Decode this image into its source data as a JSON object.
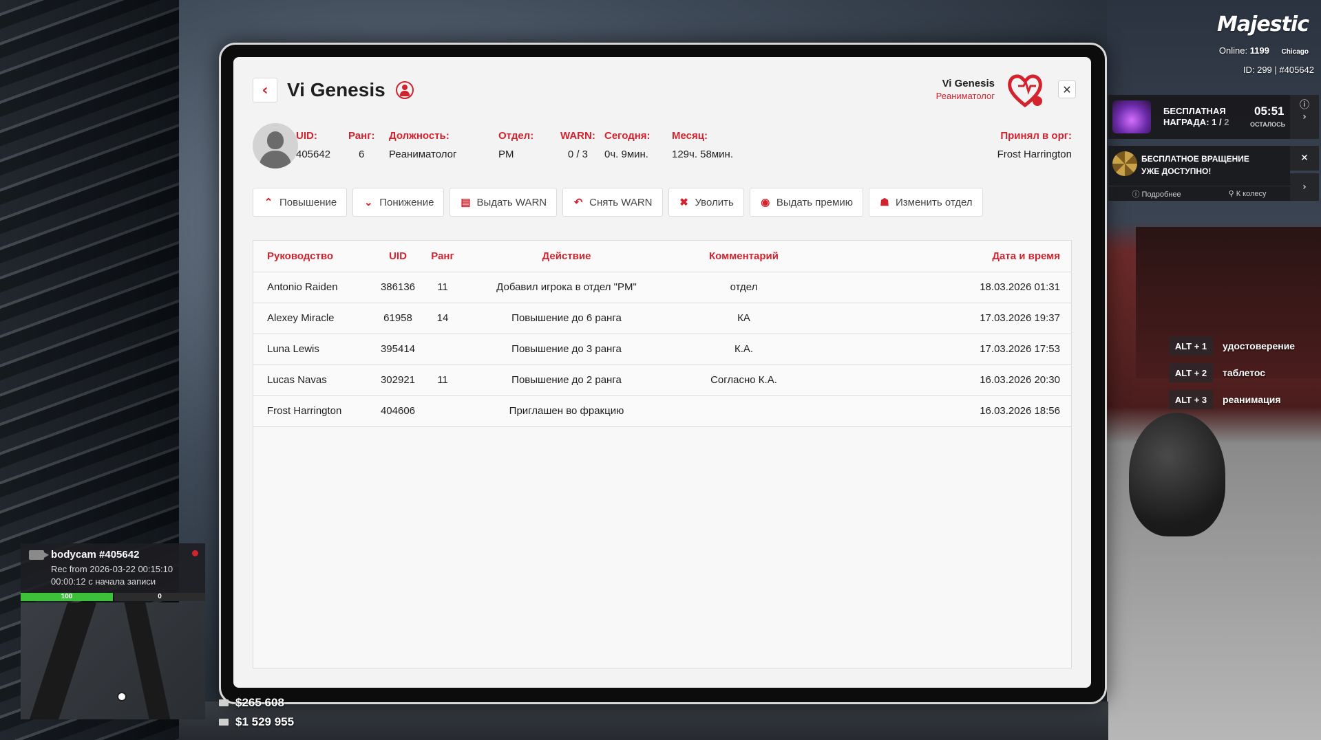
{
  "profile": {
    "name": "Vi Genesis",
    "corner_name": "Vi Genesis",
    "corner_role": "Реаниматолог",
    "fields": {
      "uid": {
        "label": "UID:",
        "value": "405642"
      },
      "rank": {
        "label": "Ранг:",
        "value": "6"
      },
      "position": {
        "label": "Должность:",
        "value": "Реаниматолог"
      },
      "department": {
        "label": "Отдел:",
        "value": "PM"
      },
      "warn": {
        "label": "WARN:",
        "value": "0 / 3"
      },
      "today": {
        "label": "Сегодня:",
        "value": "0ч. 9мин."
      },
      "month": {
        "label": "Месяц:",
        "value": "129ч. 58мин."
      },
      "accepted_by": {
        "label": "Принял в орг:",
        "value": "Frost Harrington"
      }
    }
  },
  "actions": [
    {
      "icon": "chevron-up-icon",
      "label": "Повышение"
    },
    {
      "icon": "chevron-down-icon",
      "label": "Понижение"
    },
    {
      "icon": "warn-add-icon",
      "label": "Выдать WARN"
    },
    {
      "icon": "undo-arrow-icon",
      "label": "Снять WARN"
    },
    {
      "icon": "dismiss-icon",
      "label": "Уволить"
    },
    {
      "icon": "bonus-coin-icon",
      "label": "Выдать премию"
    },
    {
      "icon": "department-tree-icon",
      "label": "Изменить отдел"
    }
  ],
  "table": {
    "headers": {
      "manager": "Руководство",
      "uid": "UID",
      "rank": "Ранг",
      "action": "Действие",
      "comment": "Комментарий",
      "datetime": "Дата и время"
    },
    "rows": [
      {
        "manager": "Antonio Raiden",
        "uid": "386136",
        "rank": "11",
        "action": "Добавил игрока в отдел \"PM\"",
        "comment": "отдел",
        "datetime": "18.03.2026 01:31"
      },
      {
        "manager": "Alexey Miracle",
        "uid": "61958",
        "rank": "14",
        "action": "Повышение до 6 ранга",
        "comment": "КА",
        "datetime": "17.03.2026 19:37"
      },
      {
        "manager": "Luna Lewis",
        "uid": "395414",
        "rank": "",
        "action": "Повышение до 3 ранга",
        "comment": "К.А.",
        "datetime": "17.03.2026 17:53"
      },
      {
        "manager": "Lucas Navas",
        "uid": "302921",
        "rank": "11",
        "action": "Повышение до 2 ранга",
        "comment": "Согласно К.А.",
        "datetime": "16.03.2026 20:30"
      },
      {
        "manager": "Frost Harrington",
        "uid": "404606",
        "rank": "",
        "action": "Приглашен во фракцию",
        "comment": "",
        "datetime": "16.03.2026 18:56"
      }
    ]
  },
  "hud": {
    "brand": "Majestic",
    "online_label": "Online:",
    "online_count": "1199",
    "server": "Chicago",
    "id_line": "ID: 299 | #405642",
    "reward": {
      "title_line1": "БЕСПЛАТНАЯ",
      "title_line2": "НАГРАДА: 1 /",
      "total": "2",
      "timer": "05:51",
      "timer_label": "ОСТАЛОСЬ"
    },
    "spin": {
      "line1": "БЕСПЛАТНОЕ ВРАЩЕНИЕ",
      "line2": "УЖЕ ДОСТУПНО!",
      "details": "Подробнее",
      "to_wheel": "К колесу"
    },
    "hotkeys": [
      {
        "key": "ALT + 1",
        "label": "удостоверение"
      },
      {
        "key": "ALT + 2",
        "label": "таблетос"
      },
      {
        "key": "ALT + 3",
        "label": "реанимация"
      }
    ],
    "bodycam": {
      "title": "bodycam #405642",
      "rec": "Rec from 2026-03-22 00:15:10",
      "elapsed": "00:00:12 с начала записи"
    },
    "health": 100,
    "health_label": "100",
    "armor_label": "0",
    "cash": "$265 608",
    "bank": "$1 529 955"
  },
  "colors": {
    "accent": "#d3232e",
    "panel": "#f3f3f3"
  }
}
